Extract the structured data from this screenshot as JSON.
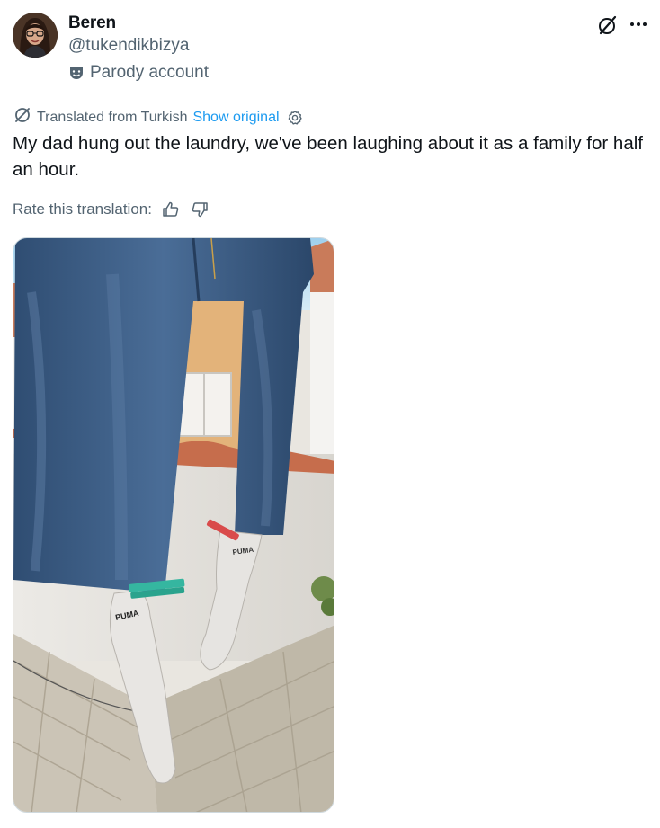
{
  "author": {
    "display_name": "Beren",
    "handle": "@tukendikbizya",
    "label": "Parody account",
    "avatar_icon": "profile-avatar",
    "label_icon": "theater-mask-icon"
  },
  "header_actions": {
    "grok_icon": "grok-icon",
    "more_icon": "more-options-icon"
  },
  "translation": {
    "translated_from": "Translated from Turkish",
    "show_original": "Show original",
    "settings_icon": "gear-icon"
  },
  "tweet": {
    "text": "My dad hung out the laundry, we've been laughing about it as a family for half an hour."
  },
  "rating": {
    "label": "Rate this translation:",
    "thumbs_up_icon": "thumbs-up-icon",
    "thumbs_down_icon": "thumbs-down-icon"
  },
  "media": {
    "sock_brand": "PUMA"
  },
  "colors": {
    "text": "#0f1419",
    "secondary": "#536471",
    "link": "#1d9bf0",
    "border": "#cfd9de"
  }
}
